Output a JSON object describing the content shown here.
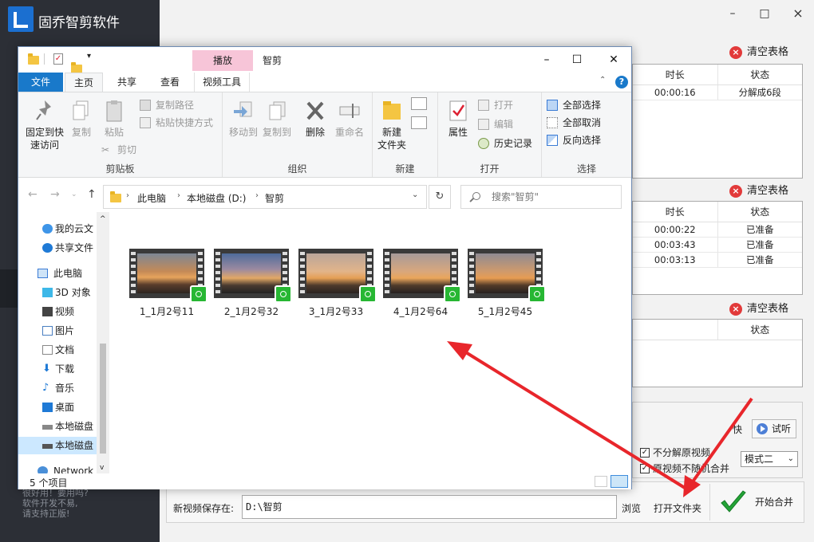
{
  "app": {
    "title": "固乔智剪软件",
    "window_controls": {
      "minimize": "–",
      "maximize": "□",
      "close": "×"
    },
    "sidebar_note": [
      "很好用！要用吗?",
      "软件开发不易,",
      "请支持正版!"
    ],
    "clear_label": "清空表格",
    "tables": [
      {
        "headers": [
          "时长",
          "状态"
        ],
        "rows": [
          [
            "00:00:16",
            "分解成6段"
          ]
        ]
      },
      {
        "headers": [
          "时长",
          "状态"
        ],
        "rows": [
          [
            "00:00:22",
            "已准备"
          ],
          [
            "00:03:43",
            "已准备"
          ],
          [
            "00:03:13",
            "已准备"
          ]
        ]
      },
      {
        "headers": [
          "",
          "状态"
        ],
        "rows": []
      }
    ],
    "speed_fragment": "快",
    "preview_button": "试听",
    "option_no_split": "不分解原视频",
    "option_no_random": "原视频不随机合并",
    "mode_value": "模式二",
    "save_label": "新视频保存在:",
    "save_path": "D:\\智剪",
    "browse_button": "浏览",
    "open_folder_button": "打开文件夹",
    "start_merge_button": "开始合并"
  },
  "explorer": {
    "title": "智剪",
    "context_tab": "播放",
    "tabs": [
      "文件",
      "主页",
      "共享",
      "查看",
      "视频工具"
    ],
    "ribbon": {
      "clipboard": {
        "label": "剪贴板",
        "pin": "固定到快速访问",
        "copy": "复制",
        "paste": "粘贴",
        "copy_path": "复制路径",
        "paste_shortcut": "粘贴快捷方式",
        "cut": "剪切"
      },
      "organize": {
        "label": "组织",
        "move_to": "移动到",
        "copy_to": "复制到",
        "delete": "删除",
        "rename": "重命名"
      },
      "new": {
        "label": "新建",
        "new_folder": "新建\n文件夹"
      },
      "open": {
        "label": "打开",
        "properties": "属性",
        "open": "打开",
        "edit": "编辑",
        "history": "历史记录"
      },
      "select": {
        "label": "选择",
        "select_all": "全部选择",
        "select_none": "全部取消",
        "invert": "反向选择"
      }
    },
    "breadcrumb": [
      "此电脑",
      "本地磁盘 (D:)",
      "智剪"
    ],
    "search_placeholder": "搜索\"智剪\"",
    "nav": [
      {
        "label": "我的云文"
      },
      {
        "label": "共享文件"
      },
      {
        "label": "此电脑"
      },
      {
        "label": "3D 对象"
      },
      {
        "label": "视频"
      },
      {
        "label": "图片"
      },
      {
        "label": "文档"
      },
      {
        "label": "下载"
      },
      {
        "label": "音乐"
      },
      {
        "label": "桌面"
      },
      {
        "label": "本地磁盘"
      },
      {
        "label": "本地磁盘"
      },
      {
        "label": "Network"
      }
    ],
    "files": [
      "1_1月2号11",
      "2_1月2号32",
      "3_1月2号33",
      "4_1月2号64",
      "5_1月2号45"
    ],
    "status": "5 个项目"
  },
  "colors": {
    "accent": "#1979ca",
    "arrow": "#e8262b",
    "video_badge": "#27b733",
    "context_tab": "#f7c5d8"
  }
}
